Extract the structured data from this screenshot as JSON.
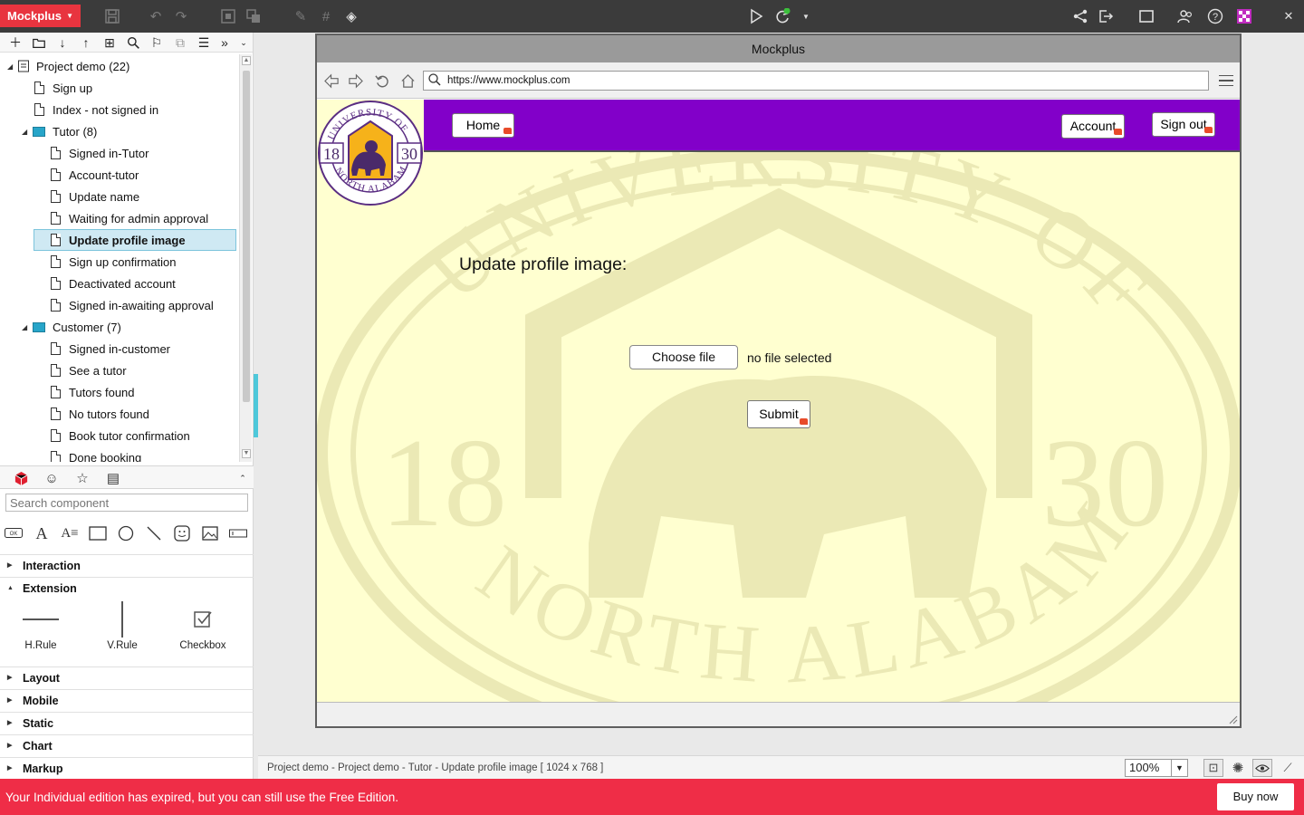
{
  "app": {
    "name": "Mockplus",
    "brand_color": "#e8343f"
  },
  "tree": {
    "items": [
      {
        "label": "Project demo (22)",
        "type": "project"
      },
      {
        "label": "Sign up",
        "type": "page"
      },
      {
        "label": "Index - not signed in",
        "type": "page"
      },
      {
        "label": "Tutor (8)",
        "type": "folder"
      },
      {
        "label": "Signed in-Tutor",
        "type": "page"
      },
      {
        "label": "Account-tutor",
        "type": "page"
      },
      {
        "label": "Update name",
        "type": "page"
      },
      {
        "label": "Waiting for admin approval",
        "type": "page"
      },
      {
        "label": "Update profile image",
        "type": "page",
        "selected": true
      },
      {
        "label": "Sign up confirmation",
        "type": "page"
      },
      {
        "label": "Deactivated account",
        "type": "page"
      },
      {
        "label": "Signed in-awaiting approval",
        "type": "page"
      },
      {
        "label": "Customer (7)",
        "type": "folder"
      },
      {
        "label": "Signed in-customer",
        "type": "page"
      },
      {
        "label": "See a tutor",
        "type": "page"
      },
      {
        "label": "Tutors found",
        "type": "page"
      },
      {
        "label": "No tutors found",
        "type": "page"
      },
      {
        "label": "Book tutor confirmation",
        "type": "page"
      },
      {
        "label": "Done booking",
        "type": "page"
      }
    ]
  },
  "components": {
    "search_placeholder": "Search component",
    "sections": {
      "interaction": "Interaction",
      "extension": "Extension",
      "layout": "Layout",
      "mobile": "Mobile",
      "static": "Static",
      "chart": "Chart",
      "markup": "Markup"
    },
    "extension_items": [
      "H.Rule",
      "V.Rule",
      "Checkbox"
    ]
  },
  "mock": {
    "window_title": "Mockplus",
    "url": "https://www.mockplus.com",
    "nav": {
      "home": "Home",
      "account": "Account",
      "sign_out": "Sign out"
    },
    "seal": {
      "top_text": "UNIVERSITY OF",
      "bottom_text": "NORTH ALABAMA",
      "year_left": "18",
      "year_right": "30"
    },
    "heading": "Update profile image:",
    "choose_file": "Choose file",
    "no_file": "no file selected",
    "submit": "Submit",
    "bar_color": "#8200c9",
    "page_bg": "#ffffd0"
  },
  "status": {
    "breadcrumb": "Project demo - Project demo - Tutor - Update profile image [ 1024 x 768 ]",
    "zoom": "100%"
  },
  "banner": {
    "message": "Your Individual edition has expired, but you can still use the Free Edition.",
    "buy_now": "Buy now",
    "color": "#ef2d47"
  }
}
